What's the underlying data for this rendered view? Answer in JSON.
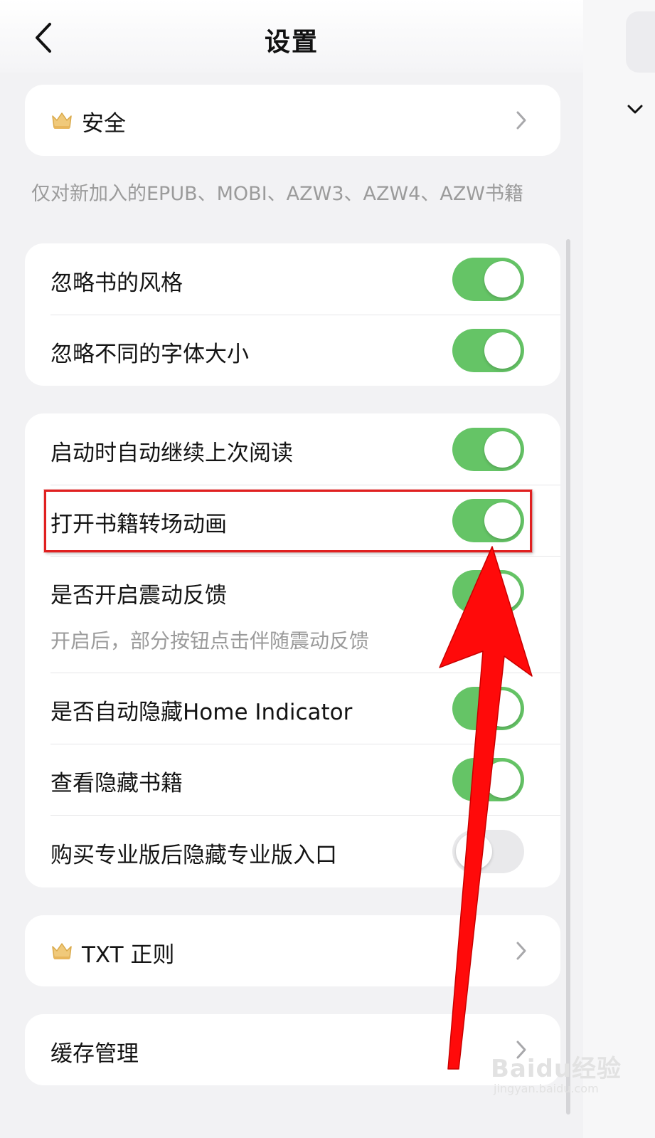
{
  "header": {
    "title": "设置",
    "back_icon": "chevron-left-icon"
  },
  "security": {
    "label": "安全",
    "icon": "crown-icon"
  },
  "note": "仅对新加入的EPUB、MOBI、AZW3、AZW4、AZW书籍",
  "group1": [
    {
      "label": "忽略书的风格",
      "on": true
    },
    {
      "label": "忽略不同的字体大小",
      "on": true
    }
  ],
  "group2": [
    {
      "label": "启动时自动继续上次阅读",
      "on": true
    },
    {
      "label": "打开书籍转场动画",
      "on": true
    },
    {
      "label": "是否开启震动反馈",
      "sub": "开启后，部分按钮点击伴随震动反馈",
      "on": true
    },
    {
      "label": "是否自动隐藏Home Indicator",
      "on": true
    },
    {
      "label": "查看隐藏书籍",
      "on": true
    },
    {
      "label": "购买专业版后隐藏专业版入口",
      "on": false
    }
  ],
  "txt_rule": {
    "label": "TXT 正则",
    "icon": "crown-icon"
  },
  "cache": {
    "label": "缓存管理"
  },
  "watermark": {
    "main": "Baidu经验",
    "sub": "jingyan.baidu.com"
  },
  "colors": {
    "toggle_on": "#65c466",
    "toggle_off": "#e9e9eb",
    "highlight": "#e02020",
    "arrow": "#ff0a0a"
  }
}
